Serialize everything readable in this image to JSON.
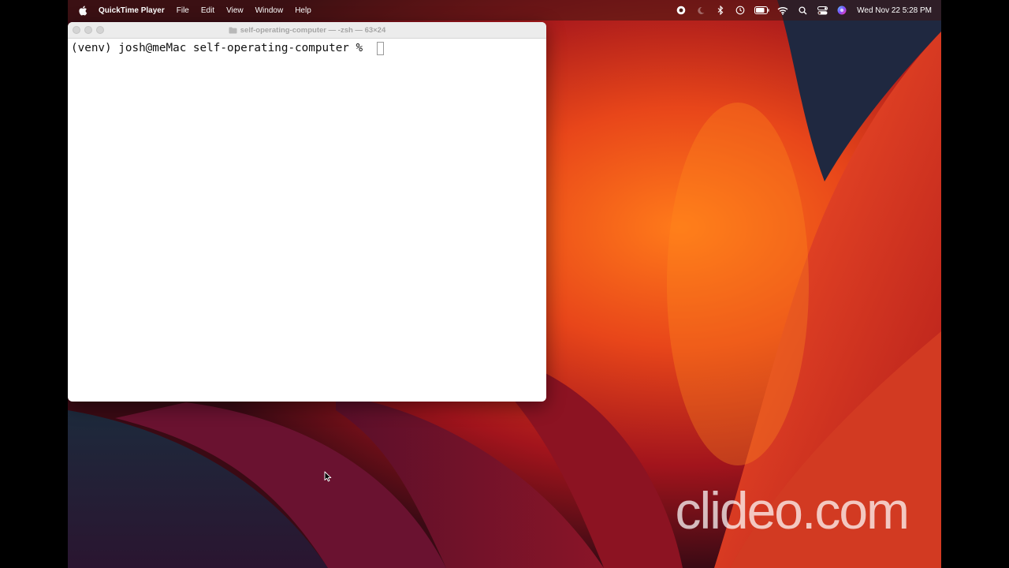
{
  "menubar": {
    "apple_icon": "apple-logo-icon",
    "app_name": "QuickTime Player",
    "menus": [
      "File",
      "Edit",
      "View",
      "Window",
      "Help"
    ],
    "status_icons": [
      "record-icon",
      "moon-icon",
      "bluetooth-icon",
      "time-machine-icon",
      "battery-icon",
      "wifi-icon",
      "search-icon",
      "control-center-icon",
      "siri-icon"
    ],
    "clock": "Wed Nov 22  5:28 PM"
  },
  "terminal": {
    "title": "self-operating-computer — -zsh — 63×24",
    "prompt": "(venv) josh@meMac self-operating-computer % "
  },
  "watermark": "clideo.com",
  "colors": {
    "wallpaper_dark": "#3a0a14",
    "wallpaper_orange": "#e8551c",
    "wallpaper_red": "#c62a1e",
    "terminal_bg": "#ffffff"
  }
}
